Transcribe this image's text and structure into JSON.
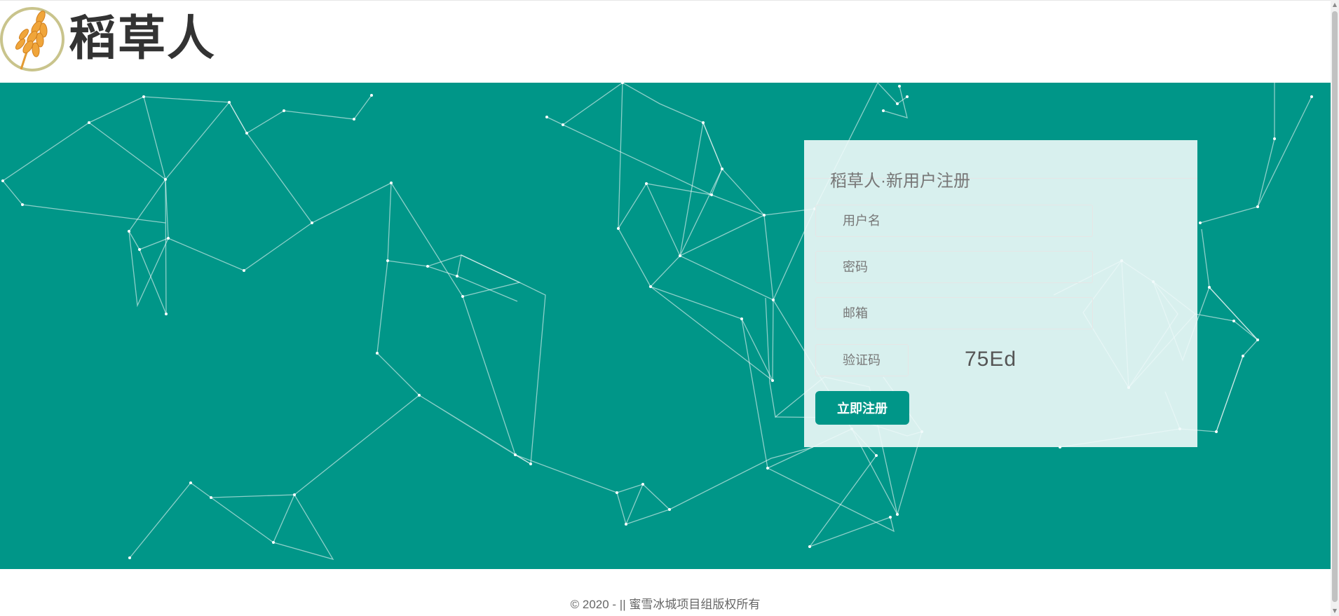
{
  "header": {
    "logo_text": "稻草人",
    "logo_icon": "wheat-icon"
  },
  "register": {
    "title": "稻草人·新用户注册",
    "username_placeholder": "用户名",
    "password_placeholder": "密码",
    "email_placeholder": "邮箱",
    "captcha_placeholder": "验证码",
    "captcha_code": "75Ed",
    "submit_label": "立即注册"
  },
  "footer": {
    "copyright": "© 2020 - || 蜜雪冰城项目组版权所有"
  },
  "colors": {
    "brand": "#009688",
    "card": "#eef7f7",
    "line": "#ffffff"
  }
}
